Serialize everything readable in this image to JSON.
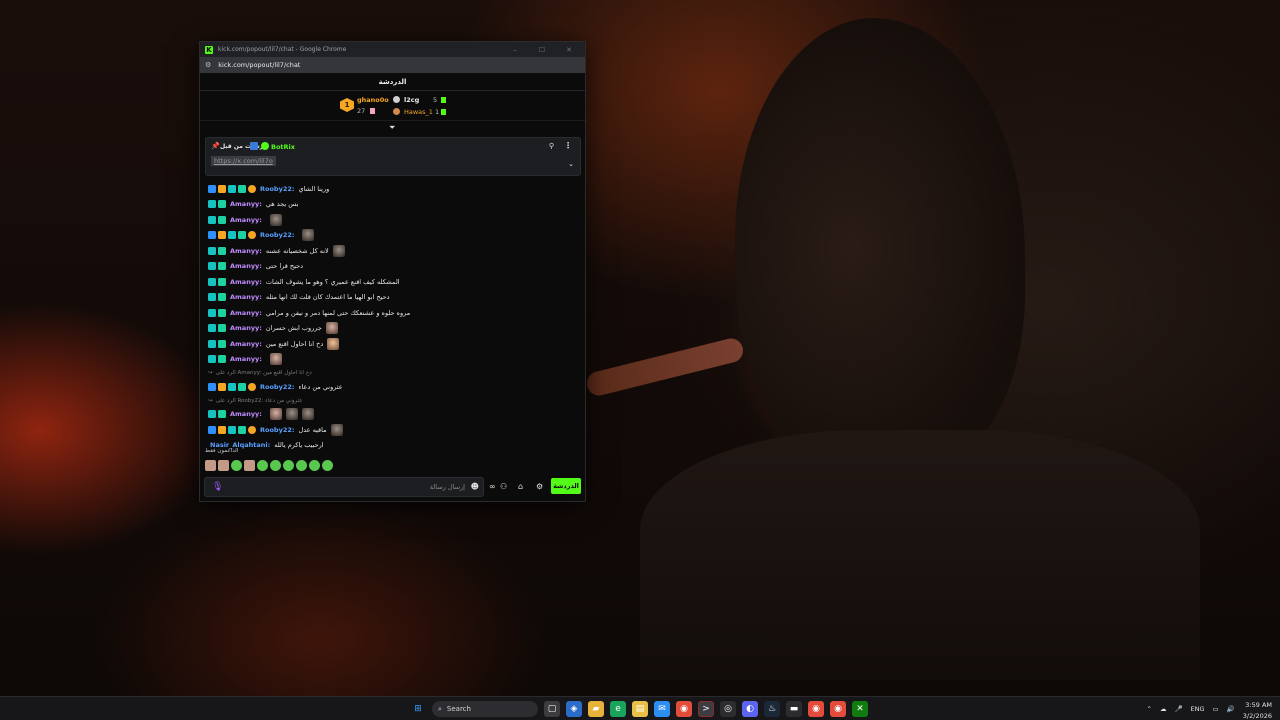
{
  "browser": {
    "title": "kick.com/popout/lil7/chat - Google Chrome",
    "url": "kick.com/popout/lil7/chat"
  },
  "chat": {
    "header": "الدردشة",
    "leaderboard": {
      "first": {
        "rank": "1",
        "name": "ghano0o",
        "count": "27"
      },
      "second": {
        "name": "l2cg",
        "count": "5"
      },
      "third": {
        "name": "Hawas_1",
        "count": "1"
      }
    },
    "pinned": {
      "by_label": "أرسلت من قبل",
      "user": "BotRix",
      "link": "https://x.com/lil7o"
    },
    "messages": [
      {
        "type": "msg",
        "badges": [
          "b-mod",
          "b-og",
          "b-sub",
          "b-ver",
          "b-gold"
        ],
        "user": "Rooby22:",
        "color": "u-blue",
        "text": "ورينا الشاي",
        "emotes": []
      },
      {
        "type": "msg",
        "badges": [
          "b-sub",
          "b-ver"
        ],
        "user": "Amanyy:",
        "color": "u-purple",
        "text": "بس يجد هي",
        "emotes": []
      },
      {
        "type": "msg",
        "badges": [
          "b-sub",
          "b-ver"
        ],
        "user": "Amanyy:",
        "color": "u-purple",
        "text": "",
        "emotes": [
          "e2"
        ]
      },
      {
        "type": "msg",
        "badges": [
          "b-mod",
          "b-og",
          "b-sub",
          "b-ver",
          "b-gold"
        ],
        "user": "Rooby22:",
        "color": "u-blue",
        "text": "",
        "emotes": [
          "e2"
        ]
      },
      {
        "type": "msg",
        "badges": [
          "b-sub",
          "b-ver"
        ],
        "user": "Amanyy:",
        "color": "u-purple",
        "text": "لانه كل شخصياته عشنه",
        "emotes": [
          "e2"
        ]
      },
      {
        "type": "msg",
        "badges": [
          "b-sub",
          "b-ver"
        ],
        "user": "Amanyy:",
        "color": "u-purple",
        "text": "دحيح قرا حتى",
        "emotes": []
      },
      {
        "type": "msg",
        "badges": [
          "b-sub",
          "b-ver"
        ],
        "user": "Amanyy:",
        "color": "u-purple",
        "text": "المشكله كيف اقنع عميري ؟ وهو ما يشوف الشات",
        "emotes": []
      },
      {
        "type": "msg",
        "badges": [
          "b-sub",
          "b-ver"
        ],
        "user": "Amanyy:",
        "color": "u-purple",
        "text": "دحيح ابو الهيا ما اعتمدك كان قلت لك انها مثله",
        "emotes": []
      },
      {
        "type": "msg",
        "badges": [
          "b-sub",
          "b-ver"
        ],
        "user": "Amanyy:",
        "color": "u-purple",
        "text": "مروه حلوه و عشنعكك حتى لمنها دمر و نيفن و مرامي",
        "emotes": []
      },
      {
        "type": "msg",
        "badges": [
          "b-sub",
          "b-ver"
        ],
        "user": "Amanyy:",
        "color": "u-purple",
        "text": "جرروب ابش حسران",
        "emotes": [
          "e1"
        ]
      },
      {
        "type": "msg",
        "badges": [
          "b-sub",
          "b-ver"
        ],
        "user": "Amanyy:",
        "color": "u-purple",
        "text": "دخ انا احاول اقنع مين",
        "emotes": [
          "e3"
        ]
      },
      {
        "type": "msg",
        "badges": [
          "b-sub",
          "b-ver"
        ],
        "user": "Amanyy:",
        "color": "u-purple",
        "text": "",
        "emotes": [
          "e1"
        ]
      },
      {
        "type": "reply",
        "text": "الرد على Amanyy: دخ انا احاول اقنع مين"
      },
      {
        "type": "msg",
        "badges": [
          "b-mod",
          "b-og",
          "b-sub",
          "b-ver",
          "b-gold"
        ],
        "user": "Rooby22:",
        "color": "u-blue",
        "text": "عثروني من دعاء",
        "emotes": []
      },
      {
        "type": "reply",
        "text": "الرد على Rooby22: عثروني من دعاء"
      },
      {
        "type": "msg",
        "badges": [
          "b-sub",
          "b-ver"
        ],
        "user": "Amanyy:",
        "color": "u-purple",
        "text": "",
        "emotes": [
          "e1",
          "e2",
          "e2"
        ]
      },
      {
        "type": "msg",
        "badges": [
          "b-mod",
          "b-og",
          "b-sub",
          "b-ver",
          "b-gold"
        ],
        "user": "Rooby22:",
        "color": "u-blue",
        "text": "ماقيه عدل",
        "emotes": [
          "e2"
        ]
      },
      {
        "type": "msg",
        "badges": [],
        "user": "Nasir_Alqahtani:",
        "color": "u-blue",
        "text": "ارحبيب ياكرم يالله",
        "emotes": []
      }
    ],
    "top_supporters_label": "الداعمون فقط",
    "input_placeholder": "إرسال رسالة",
    "send_label": "الدردشة"
  },
  "taskbar": {
    "search_label": "Search",
    "lang": "ENG",
    "time": "3:59 AM",
    "date": "3/2/2026"
  },
  "colors": {
    "accent": "#53fc18",
    "gold": "#f5a623"
  }
}
